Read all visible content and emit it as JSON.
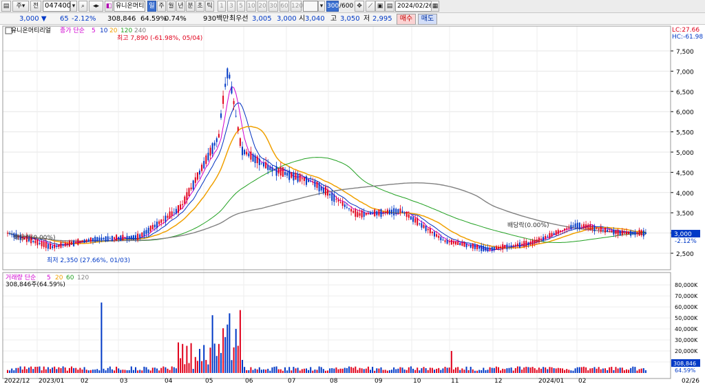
{
  "toolbar": {
    "mode": "주",
    "market": "전",
    "code": "047400",
    "name_short": "유니온머티",
    "periods": [
      "일",
      "주",
      "월",
      "년",
      "분",
      "초",
      "틱"
    ],
    "selected_period": "일",
    "minutes": [
      "1",
      "3",
      "5",
      "10",
      "20",
      "30",
      "60",
      "120"
    ],
    "count_value": "300",
    "count_max": "/600",
    "date": "2024/02/26"
  },
  "quote": {
    "price": "3,000",
    "change": "65",
    "change_pct": "-2.12%",
    "volume": "308,846",
    "volume_ratio": "64.59%",
    "turnover": "0.74%",
    "amount": "930백만",
    "bid_label": "최우선",
    "bid1": "3,005",
    "bid2": "3,000",
    "open_label": "시",
    "open": "3,040",
    "high_label": "고",
    "high": "3,050",
    "low_label": "저",
    "low": "2,995",
    "buy_label": "매수",
    "sell_label": "매도"
  },
  "colors": {
    "up": "#e0001b",
    "down": "#0039c6",
    "ma5": "#d000d0",
    "ma10": "#0030c0",
    "ma20": "#f0a000",
    "ma60": "#20a020",
    "ma120": "#808080",
    "ma240": "#303030"
  },
  "chart_data": {
    "type": "candlestick",
    "stock_name": "유니온머티리얼",
    "legend": {
      "prefix": "종가 단순",
      "periods": [
        "5",
        "10",
        "20",
        "120",
        "240"
      ]
    },
    "x_axis": {
      "labels": [
        "2022/12",
        "2023/01",
        "02",
        "03",
        "04",
        "05",
        "06",
        "07",
        "08",
        "09",
        "10",
        "11",
        "12",
        "2024/01",
        "02",
        "02/26"
      ]
    },
    "price_axis": {
      "ticks": [
        "2,500",
        "3,000",
        "3,500",
        "4,000",
        "4,500",
        "5,000",
        "5,500",
        "6,000",
        "6,500",
        "7,000",
        "7,500"
      ],
      "current": "3,000",
      "current_pct": "-2.12%",
      "lc": "LC:27.66",
      "hc": "HC:-61.98"
    },
    "annotations": {
      "high": "최고 7,890 (-61.98%, 05/04)",
      "low": "최저 2,350 (27.66%, 01/03)",
      "div1": "배당락(0.00%)",
      "div2": "배당락(0.00%)"
    },
    "series_close_monthly": [
      {
        "x": "2022/12",
        "value": 3000
      },
      {
        "x": "2023/01",
        "value": 2650
      },
      {
        "x": "02",
        "value": 2850
      },
      {
        "x": "03",
        "value": 2900
      },
      {
        "x": "04",
        "value": 3650
      },
      {
        "x": "05",
        "value": 5300
      },
      {
        "x": "06",
        "value": 4600
      },
      {
        "x": "07",
        "value": 4250
      },
      {
        "x": "08",
        "value": 3450
      },
      {
        "x": "09",
        "value": 3550
      },
      {
        "x": "10",
        "value": 2800
      },
      {
        "x": "11",
        "value": 2600
      },
      {
        "x": "12",
        "value": 2750
      },
      {
        "x": "2024/01",
        "value": 3200
      },
      {
        "x": "02",
        "value": 3000
      }
    ],
    "volume_panel": {
      "legend": {
        "prefix": "거래량 단순",
        "periods": [
          "5",
          "20",
          "60",
          "120"
        ]
      },
      "current_text": "308,846주(64.59%)",
      "ticks": [
        "10,000K",
        "20,000K",
        "30,000K",
        "40,000K",
        "50,000K",
        "60,000K",
        "70,000K",
        "80,000K"
      ],
      "current": "308,846",
      "current_pct": "64.59%"
    }
  }
}
